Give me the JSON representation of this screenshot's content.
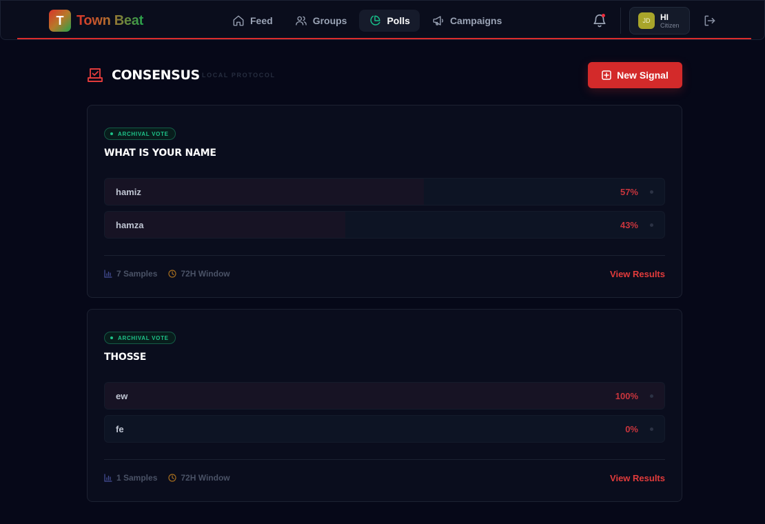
{
  "app": {
    "logo_letter": "T",
    "name": "Town Beat"
  },
  "nav": [
    {
      "label": "Feed",
      "icon": "home-icon",
      "active": false
    },
    {
      "label": "Groups",
      "icon": "users-icon",
      "active": false
    },
    {
      "label": "Polls",
      "icon": "pie-chart-icon",
      "active": true
    },
    {
      "label": "Campaigns",
      "icon": "megaphone-icon",
      "active": false
    }
  ],
  "user": {
    "initials": "JD",
    "greeting": "HI",
    "role": "Citizen"
  },
  "page": {
    "title": "CONSENSUS",
    "subtitle": "LOCAL PROTOCOL",
    "new_button": "New Signal"
  },
  "polls": [
    {
      "badge": "ARCHIVAL VOTE",
      "question": "WHAT IS YOUR NAME",
      "options": [
        {
          "label": "hamiz",
          "percent": "57%",
          "share": 57
        },
        {
          "label": "hamza",
          "percent": "43%",
          "share": 43
        }
      ],
      "samples": "7 Samples",
      "window": "72H Window",
      "action": "View Results"
    },
    {
      "badge": "ARCHIVAL VOTE",
      "question": "THOSSE",
      "options": [
        {
          "label": "ew",
          "percent": "100%",
          "share": 100
        },
        {
          "label": "fe",
          "percent": "0%",
          "share": 0
        }
      ],
      "samples": "1 Samples",
      "window": "72H Window",
      "action": "View Results"
    }
  ],
  "colors": {
    "accent": "#d32a2a",
    "success": "#1ec389",
    "background": "#060818"
  }
}
